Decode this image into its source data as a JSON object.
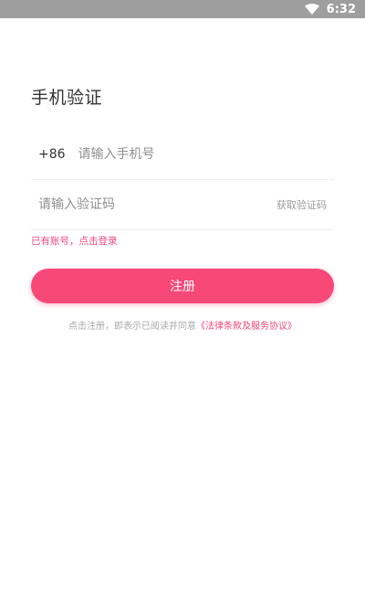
{
  "status_bar": {
    "time": "6:32",
    "icons": [
      "wifi-icon"
    ]
  },
  "page": {
    "title": "手机验证"
  },
  "phone": {
    "country_code": "+86",
    "placeholder": "请输入手机号",
    "value": ""
  },
  "code": {
    "placeholder": "请输入验证码",
    "value": "",
    "get_code_label": "获取验证码"
  },
  "login_link": "已有账号，点击登录",
  "register_button": "注册",
  "agreement": {
    "prefix": "点击注册，即表示已阅读并同意",
    "link": "《法律条款及服务协议》"
  },
  "colors": {
    "accent": "#f74878",
    "link": "#f0457a",
    "status_bar": "#9e9e9e"
  }
}
